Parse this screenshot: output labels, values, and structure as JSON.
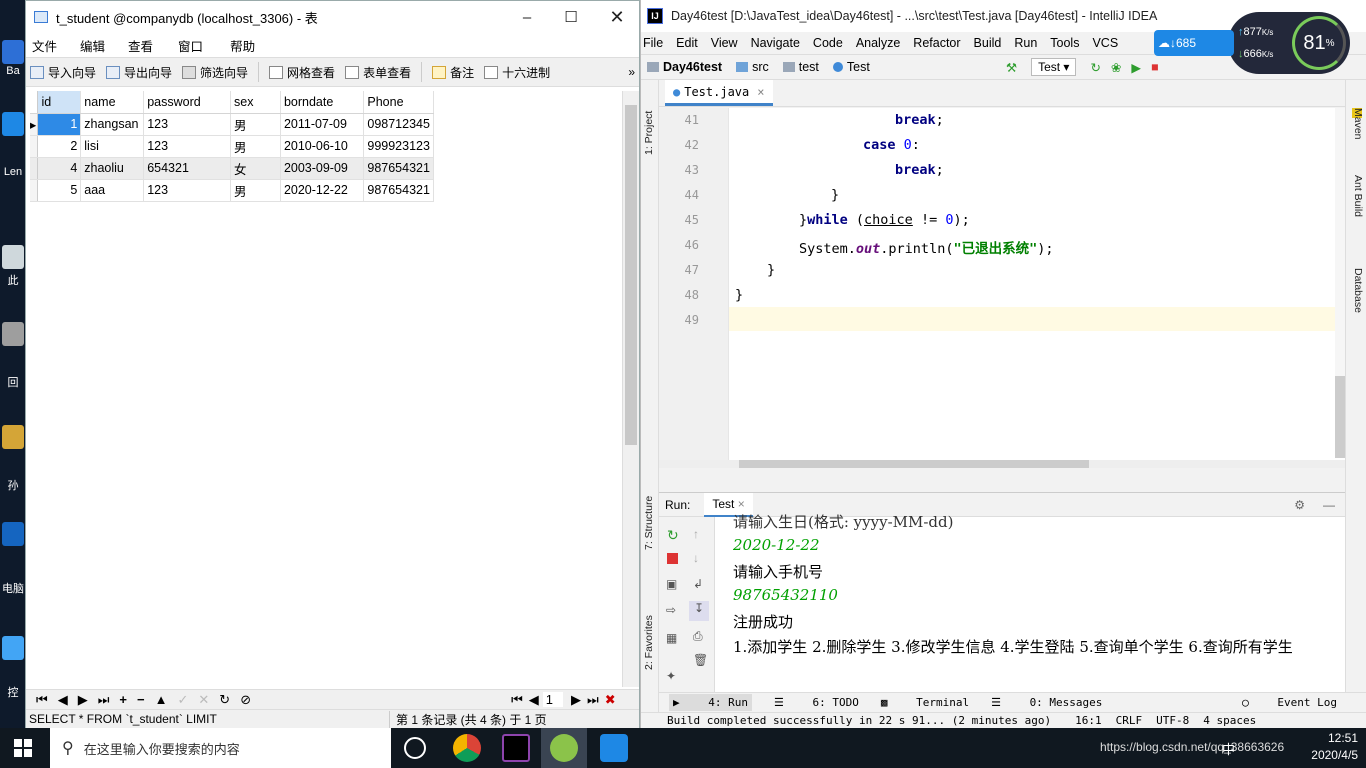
{
  "desktop": {
    "labels": [
      "Ba",
      "Len\n驱",
      "此",
      "回",
      "孙",
      "电脑\n件化",
      "控"
    ]
  },
  "navicat": {
    "title": "t_student @companydb (localhost_3306) - 表",
    "menu": [
      "文件",
      "编辑",
      "查看",
      "窗口",
      "帮助"
    ],
    "toolbar": [
      "导入向导",
      "导出向导",
      "筛选向导",
      "网格查看",
      "表单查看",
      "备注",
      "十六进制"
    ],
    "columns": [
      "id",
      "name",
      "password",
      "sex",
      "borndate",
      "Phone"
    ],
    "rows": [
      {
        "id": "1",
        "name": "zhangsan",
        "password": "123",
        "sex": "男",
        "borndate": "2011-07-09",
        "phone": "098712345"
      },
      {
        "id": "2",
        "name": "lisi",
        "password": "123",
        "sex": "男",
        "borndate": "2010-06-10",
        "phone": "999923123"
      },
      {
        "id": "4",
        "name": "zhaoliu",
        "password": "654321",
        "sex": "女",
        "borndate": "2003-09-09",
        "phone": "987654321"
      },
      {
        "id": "5",
        "name": "aaa",
        "password": "123",
        "sex": "男",
        "borndate": "2020-12-22",
        "phone": "987654321"
      }
    ],
    "page_number": "1",
    "sql": "SELECT * FROM `t_student` LIMIT",
    "record_info": "第 1 条记录 (共 4 条) 于 1 页"
  },
  "intellij": {
    "title": "Day46test [D:\\JavaTest_idea\\Day46test] - ...\\src\\test\\Test.java [Day46test] - IntelliJ IDEA",
    "menu": [
      "File",
      "Edit",
      "View",
      "Navigate",
      "Code",
      "Analyze",
      "Refactor",
      "Build",
      "Run",
      "Tools",
      "VCS"
    ],
    "breadcrumbs": [
      "Day46test",
      "src",
      "test",
      "Test"
    ],
    "run_config": "Test",
    "file_tab": "Test.java",
    "line_numbers": [
      "41",
      "42",
      "43",
      "44",
      "45",
      "46",
      "47",
      "48",
      "49"
    ],
    "code": {
      "l41": "break",
      "l42a": "case",
      "l42b": "0",
      "l43": "break",
      "l44": "}",
      "l45a": "}",
      "l45b": "while",
      "l45c": "choice",
      "l45d": "!=",
      "l45e": "0",
      "l46a": "System.",
      "l46b": "out",
      "l46c": ".println(",
      "l46d": "\"已退出系统\"",
      "l46e": ");",
      "l47": "}",
      "l48": "}"
    },
    "left_tools": [
      "1: Project",
      "7: Structure",
      "2: Favorites"
    ],
    "right_tools": [
      "Maven",
      "Ant Build",
      "Database"
    ],
    "run_label": "Run:",
    "run_tab": "Test",
    "console": [
      {
        "text": "请输入生日(格式: yyyy-MM-dd)",
        "input": false
      },
      {
        "text": "2020-12-22",
        "input": true
      },
      {
        "text": "请输入手机号",
        "input": false
      },
      {
        "text": "98765432110",
        "input": true
      },
      {
        "text": "注册成功",
        "input": false
      },
      {
        "text": "1.添加学生 2.删除学生 3.修改学生信息 4.学生登陆 5.查询单个学生 6.查询所有学生",
        "input": false
      }
    ],
    "bottom_tabs": [
      "4: Run",
      "6: TODO",
      "Terminal",
      "0: Messages"
    ],
    "event_log": "Event Log",
    "status": "Build completed successfully in 22 s 91... (2 minutes ago)",
    "cursor": "16:1",
    "line_sep": "CRLF",
    "encoding": "UTF-8",
    "indent": "4 spaces"
  },
  "netmon": {
    "up": "877",
    "down": "666",
    "unit": "K/s",
    "percent": "81",
    "pct_sign": "%",
    "cloud": "685"
  },
  "taskbar": {
    "search_placeholder": "在这里输入你要搜索的内容",
    "time": "12:51",
    "date": "2020/4/5",
    "tray_text": "https://blog.csdn.net/qq_38663626",
    "ime": "中"
  }
}
